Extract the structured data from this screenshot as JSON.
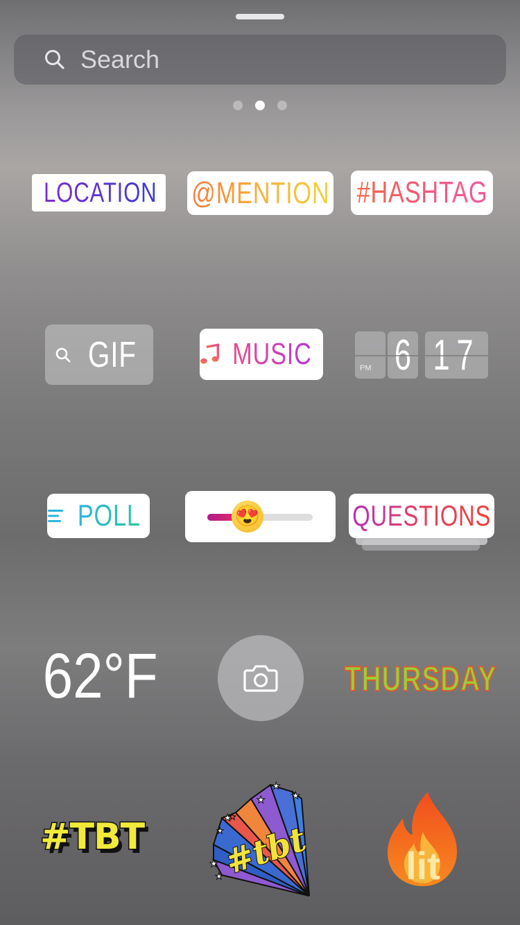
{
  "search": {
    "placeholder": "Search"
  },
  "pager": {
    "page_count": 3,
    "active_index": 1
  },
  "stickers": {
    "location": "LOCATION",
    "mention": "@MENTION",
    "hashtag": "#HASHTAG",
    "gif": "GIF",
    "music": "MUSIC",
    "clock": {
      "hour": "6",
      "minute": "17",
      "meridiem": "PM"
    },
    "poll": "POLL",
    "slider": {
      "emoji": "😍",
      "value": 0.38
    },
    "questions": "QUESTIONS",
    "temperature": "62°F",
    "day": "THURSDAY",
    "tbt": "#TBT",
    "tbt_script": "#tbt",
    "lit": "lit"
  },
  "colors": {
    "location_accent": "#7b2fcf",
    "mention_gradient": [
      "#f47b3a",
      "#f2d23c"
    ],
    "hashtag_gradient": [
      "#f0684a",
      "#ee5d9e"
    ],
    "music_gradient": [
      "#e84b8c",
      "#b93cd3"
    ],
    "poll_gradient": [
      "#2bb5e0",
      "#31c79a"
    ],
    "questions_gradient": [
      "#b52fb7",
      "#e8423a"
    ]
  },
  "icons": {
    "search": "search-icon",
    "location_pin": "location-pin-icon",
    "music_note": "music-note-icon",
    "poll_lines": "poll-lines-icon",
    "camera": "camera-icon"
  }
}
